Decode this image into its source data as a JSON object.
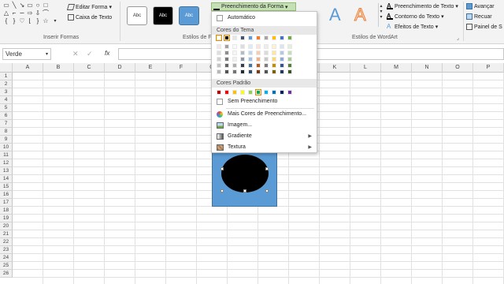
{
  "ribbon": {
    "insert_shapes": {
      "title": "Inserir Formas",
      "edit_shape_label": "Editar Forma",
      "text_box_label": "Caixa de Texto"
    },
    "shape_styles": {
      "title": "Estilos de F",
      "style1": "Abc",
      "style2": "Abc",
      "style3": "Abc"
    },
    "fill_button": "Preenchimento da Forma",
    "wordart": {
      "title": "Estilos de WordArt",
      "letter": "A",
      "text_fill": "Preenchimento de Texto",
      "text_outline": "Contorno do Texto",
      "text_effects": "Efeitos de Texto"
    },
    "arrange": {
      "forward": "Avançar",
      "backward": "Recuar",
      "pane": "Painel de S"
    }
  },
  "formula_bar": {
    "name_box": "Verde",
    "fx": "fx"
  },
  "grid": {
    "columns": [
      "A",
      "B",
      "C",
      "D",
      "E",
      "F",
      "G",
      "H",
      "I",
      "J",
      "K",
      "L",
      "M",
      "N",
      "O",
      "P"
    ],
    "rows": [
      "1",
      "2",
      "3",
      "4",
      "5",
      "6",
      "7",
      "8",
      "9",
      "10",
      "11",
      "12",
      "13",
      "14",
      "15",
      "16",
      "17",
      "18",
      "19",
      "20",
      "21",
      "22",
      "23",
      "24",
      "25",
      "26",
      "27"
    ]
  },
  "menu": {
    "automatic": "Automático",
    "theme_header": "Cores do Tema",
    "standard_header": "Cores Padrão",
    "no_fill": "Sem Preenchimento",
    "more_colors": "Mais Cores de Preenchimento...",
    "image": "Imagem...",
    "gradient": "Gradiente",
    "texture": "Textura",
    "theme_top": [
      "#ffffff",
      "#000000",
      "#e7e6e6",
      "#44546a",
      "#5b9bd5",
      "#ed7d31",
      "#a5a5a5",
      "#ffc000",
      "#4472c4",
      "#70ad47"
    ],
    "standard": [
      "#c00000",
      "#ff0000",
      "#ffc000",
      "#ffff00",
      "#92d050",
      "#00b050",
      "#00b0f0",
      "#0070c0",
      "#002060",
      "#7030a0"
    ]
  },
  "colors": {
    "shape_fill": "#5b9bd5",
    "circle": "#000000",
    "wordart_blue": "#5b9bd5",
    "wordart_orange": "#ed7d31"
  }
}
